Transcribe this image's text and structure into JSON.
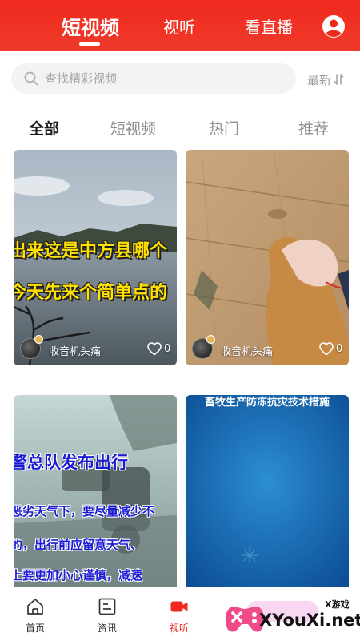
{
  "header": {
    "tabs": [
      {
        "label": "短视频",
        "active": true
      },
      {
        "label": "视听",
        "active": false
      },
      {
        "label": "看直播",
        "active": false
      }
    ],
    "account_icon": "user-circle-icon"
  },
  "search": {
    "placeholder": "查找精彩视频",
    "value": "",
    "sort_label": "最新",
    "sort_icon": "sort-arrows-icon"
  },
  "categories": [
    {
      "label": "全部",
      "active": true
    },
    {
      "label": "短视频",
      "active": false
    },
    {
      "label": "热门",
      "active": false
    },
    {
      "label": "推荐",
      "active": false
    }
  ],
  "videos": [
    {
      "captions": [
        "出来这是中方县哪个",
        "今天先来个简单点的"
      ],
      "author": "收音机头痛",
      "likes": "0"
    },
    {
      "captions": [],
      "author": "收音机头痛",
      "likes": "0"
    },
    {
      "captions": [
        "警总队发布出行",
        "恶劣天气下，要尽量减少不",
        "的，出行前应留意天气、",
        "上要更加小心谨慎，减速"
      ]
    },
    {
      "captions": [
        "畜牧生产防冻抗灾技术措施"
      ]
    }
  ],
  "bottom_nav": [
    {
      "label": "首页",
      "icon": "home-icon",
      "active": false
    },
    {
      "label": "资讯",
      "icon": "news-icon",
      "active": false
    },
    {
      "label": "视听",
      "icon": "video-camera-icon",
      "active": true
    }
  ],
  "watermark": {
    "small_text": "X游戏",
    "main_text": "XYouXi.net"
  },
  "colors": {
    "brand_red": "#f0291f",
    "caption_yellow": "#ffe100",
    "caption_blue": "#1b1bd6"
  }
}
